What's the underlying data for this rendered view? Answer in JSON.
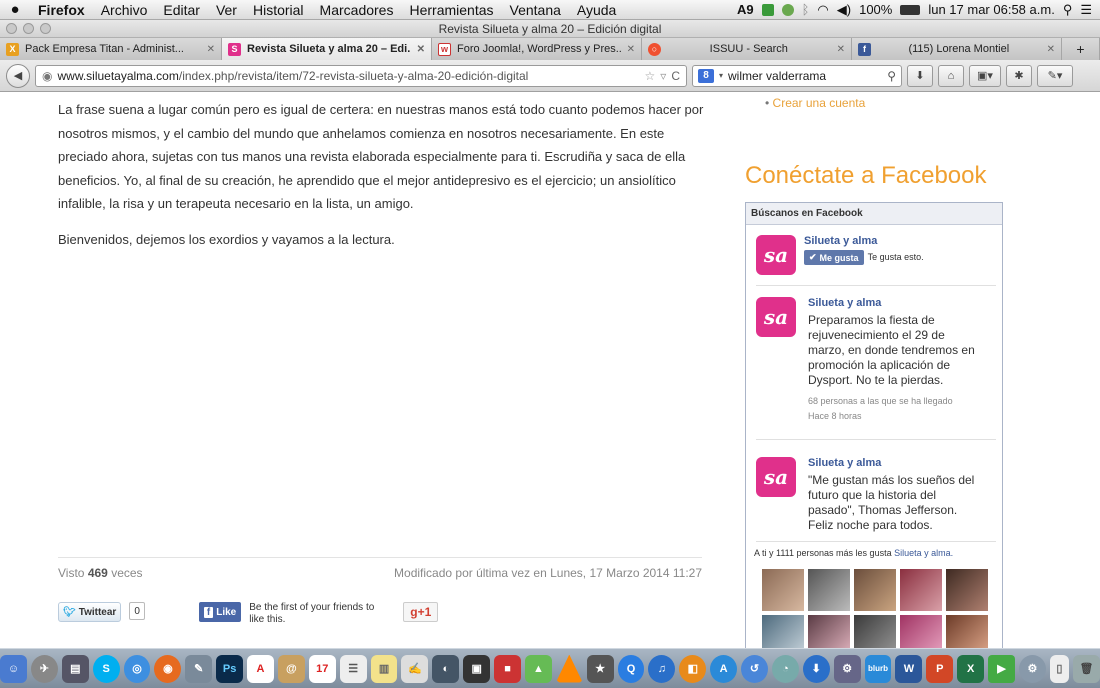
{
  "menubar": {
    "apple": "",
    "items": [
      "Firefox",
      "Archivo",
      "Editar",
      "Ver",
      "Historial",
      "Marcadores",
      "Herramientas",
      "Ventana",
      "Ayuda"
    ],
    "ai_count": "9",
    "battery": "100%",
    "clock": "lun 17 mar  06:58 a.m."
  },
  "window": {
    "title": "Revista Silueta y alma 20 – Edición digital"
  },
  "tabs": [
    {
      "label": "Pack Empresa Titan - Administ...",
      "favicon_color": "#e8a020",
      "favicon_glyph": "X"
    },
    {
      "label": "Revista Silueta y alma 20 – Edi...",
      "favicon_color": "#e0308b",
      "favicon_glyph": "S"
    },
    {
      "label": "Foro Joomla!, WordPress y Pres...",
      "favicon_color": "#cc3333",
      "favicon_glyph": "w"
    },
    {
      "label": "ISSUU - Search",
      "favicon_color": "#f05030",
      "favicon_glyph": "○"
    },
    {
      "label": "(115) Lorena Montiel",
      "favicon_color": "#3b5998",
      "favicon_glyph": "f"
    }
  ],
  "navbar": {
    "url_domain": "www.siluetayalma.com",
    "url_path": "/index.php/revista/item/72-revista-silueta-y-alma-20-edición-digital",
    "search_engine_glyph": "8",
    "search_value": "wilmer valderrama"
  },
  "article": {
    "p1": "La frase suena a lugar común pero es igual de certera: en nuestras manos está todo cuanto podemos hacer por nosotros mismos, y el cambio del mundo que anhelamos comienza en nosotros necesariamente. En este preciado ahora, sujetas con tus manos una revista elaborada especialmente para ti. Escrudiña y saca de ella beneficios. Yo, al final de su creación, he aprendido que el mejor antidepresivo es el ejercicio; un ansiolítico infalible, la risa y un terapeuta necesario en la lista, un amigo.",
    "p2": "Bienvenidos, dejemos los exordios y vayamos a la lectura.",
    "views_prefix": "Visto",
    "views_count": "469",
    "views_suffix": "veces",
    "modified": "Modificado por última vez en Lunes, 17 Marzo 2014 11:27"
  },
  "share": {
    "tweet_label": "Twittear",
    "tweet_count": "0",
    "fb_like_label": "Like",
    "fb_text": "Be the first of your friends to like this.",
    "gplus_label": "g+1"
  },
  "sidebar": {
    "create_account": "Crear una cuenta",
    "facebook_heading": "Conéctate a Facebook",
    "fb_box_title": "Búscanos en Facebook",
    "page_name": "Silueta y alma",
    "me_gusta": "Me gusta",
    "likes_this": "Te gusta esto.",
    "logo_text": "sa",
    "posts": [
      {
        "author": "Silueta y alma",
        "body": "Preparamos la fiesta de rejuvenecimiento el 29 de marzo, en donde tendremos en promoción la aplicación de Dysport. No te la pierdas.",
        "reach": "68 personas a las que se ha llegado",
        "time": "Hace 8 horas"
      },
      {
        "author": "Silueta y alma",
        "body": "\"Me gustan más los sueños del futuro que la historia del pasado\", Thomas Jefferson. Feliz noche para todos.",
        "reach": "",
        "time": ""
      }
    ],
    "friends_prefix": "A ti y 1111 personas más les gusta",
    "friends_page": "Silueta y alma."
  },
  "dock": {
    "blurb": "blurb",
    "calendar_day": "17"
  }
}
